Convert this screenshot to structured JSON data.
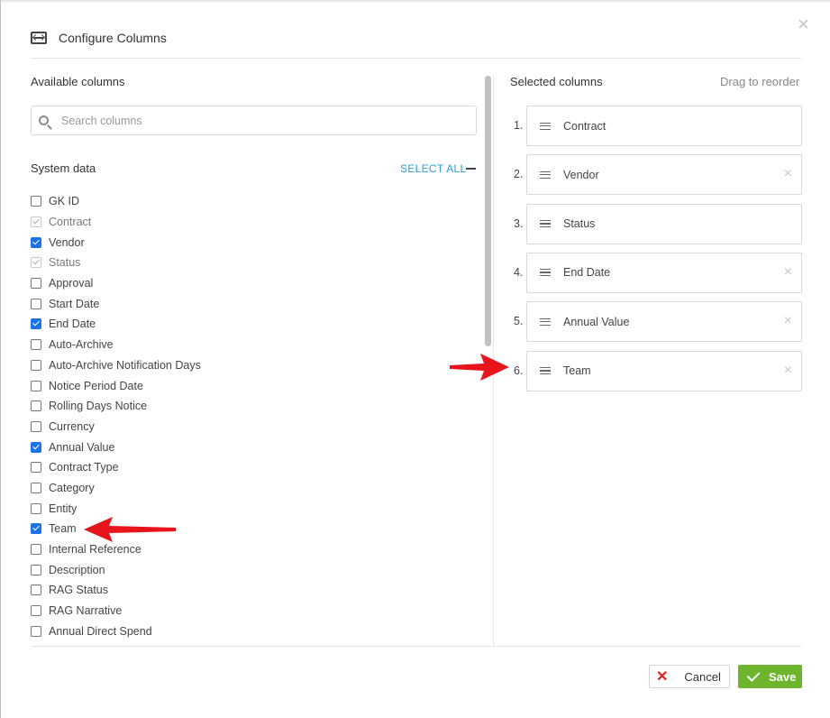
{
  "dialog": {
    "title": "Configure Columns",
    "close_icon": "close-icon",
    "header_icon": "columns-resize-icon"
  },
  "available": {
    "title": "Available columns",
    "search_placeholder": "Search columns",
    "group_title": "System data",
    "select_all_label": "SELECT ALL",
    "items": [
      {
        "label": "GK ID",
        "state": "unchecked"
      },
      {
        "label": "Contract",
        "state": "checked-disabled"
      },
      {
        "label": "Vendor",
        "state": "checked"
      },
      {
        "label": "Status",
        "state": "checked-disabled"
      },
      {
        "label": "Approval",
        "state": "unchecked"
      },
      {
        "label": "Start Date",
        "state": "unchecked"
      },
      {
        "label": "End Date",
        "state": "checked"
      },
      {
        "label": "Auto-Archive",
        "state": "unchecked"
      },
      {
        "label": "Auto-Archive Notification Days",
        "state": "unchecked"
      },
      {
        "label": "Notice Period Date",
        "state": "unchecked"
      },
      {
        "label": "Rolling Days Notice",
        "state": "unchecked"
      },
      {
        "label": "Currency",
        "state": "unchecked"
      },
      {
        "label": "Annual Value",
        "state": "checked"
      },
      {
        "label": "Contract Type",
        "state": "unchecked"
      },
      {
        "label": "Category",
        "state": "unchecked"
      },
      {
        "label": "Entity",
        "state": "unchecked"
      },
      {
        "label": "Team",
        "state": "checked"
      },
      {
        "label": "Internal Reference",
        "state": "unchecked"
      },
      {
        "label": "Description",
        "state": "unchecked"
      },
      {
        "label": "RAG Status",
        "state": "unchecked"
      },
      {
        "label": "RAG Narrative",
        "state": "unchecked"
      },
      {
        "label": "Annual Direct Spend",
        "state": "unchecked"
      }
    ]
  },
  "selected": {
    "title": "Selected columns",
    "drag_hint": "Drag to reorder",
    "items": [
      {
        "num": "1.",
        "label": "Contract",
        "removable": false
      },
      {
        "num": "2.",
        "label": "Vendor",
        "removable": true
      },
      {
        "num": "3.",
        "label": "Status",
        "removable": false
      },
      {
        "num": "4.",
        "label": "End Date",
        "removable": true
      },
      {
        "num": "5.",
        "label": "Annual Value",
        "removable": true
      },
      {
        "num": "6.",
        "label": "Team",
        "removable": true
      }
    ]
  },
  "footer": {
    "cancel_label": "Cancel",
    "save_label": "Save"
  },
  "colors": {
    "accent_link": "#2a9fd6",
    "checkbox_blue": "#1a73e8",
    "save_green": "#6cb52d",
    "cancel_red": "#e0201c",
    "annotation_arrow": "#e8141b"
  }
}
